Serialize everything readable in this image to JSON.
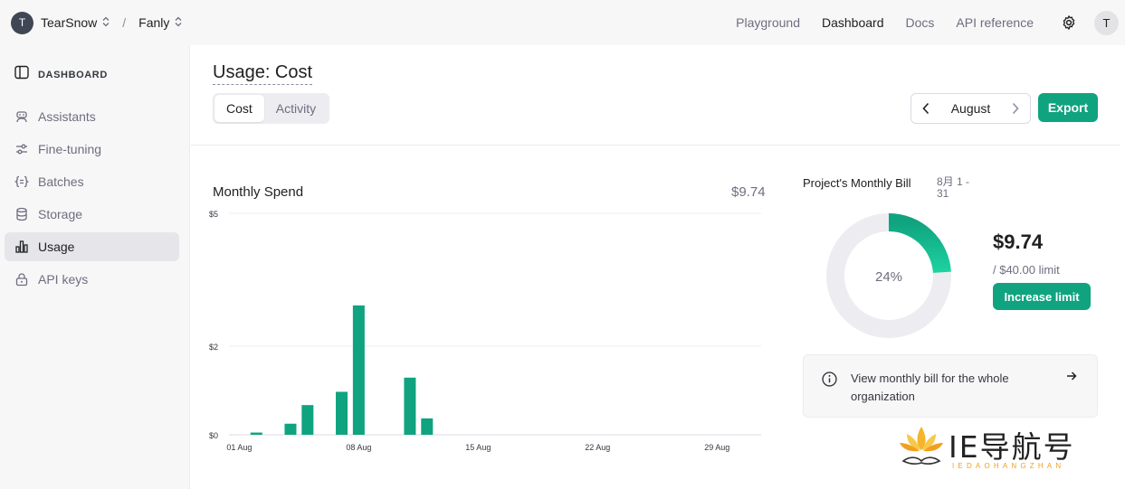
{
  "topbar": {
    "org_initial": "T",
    "org_name": "TearSnow",
    "project_name": "Fanly",
    "nav": [
      "Playground",
      "Dashboard",
      "Docs",
      "API reference"
    ],
    "active_nav": "Dashboard",
    "user_initial": "T",
    "icons": {
      "settings": "gear-icon",
      "switcher": "chevron-updown-icon"
    }
  },
  "sidebar": {
    "heading": "DASHBOARD",
    "items": [
      {
        "label": "Assistants",
        "icon": "robot-icon"
      },
      {
        "label": "Fine-tuning",
        "icon": "sliders-icon"
      },
      {
        "label": "Batches",
        "icon": "braces-icon"
      },
      {
        "label": "Storage",
        "icon": "database-icon"
      },
      {
        "label": "Usage",
        "icon": "bar-chart-icon",
        "active": true
      },
      {
        "label": "API keys",
        "icon": "lock-icon"
      }
    ]
  },
  "main": {
    "title": "Usage: Cost",
    "tabs": [
      {
        "label": "Cost",
        "active": true
      },
      {
        "label": "Activity",
        "active": false
      }
    ],
    "month": "August",
    "export_label": "Export"
  },
  "spend": {
    "title": "Monthly Spend",
    "total": "$9.74"
  },
  "bill": {
    "title": "Project's Monthly Bill",
    "range": "8月 1 - 31",
    "percent_label": "24%",
    "percent": 0.24,
    "amount": "$9.74",
    "limit": "/ $40.00 limit",
    "increase_label": "Increase limit",
    "org_link_text": "View monthly bill for the whole organization"
  },
  "colors": {
    "accent": "#10a37f",
    "track": "#ececf1",
    "donut_light": "#1dc79a"
  },
  "chart_data": {
    "type": "bar",
    "title": "Monthly Spend",
    "xlabel": "",
    "ylabel": "",
    "ylim": [
      0,
      5
    ],
    "y_ticks": [
      "$0",
      "$2",
      "$5"
    ],
    "y_tick_values": [
      0,
      2,
      5
    ],
    "x_tick_labels": [
      "01 Aug",
      "08 Aug",
      "15 Aug",
      "22 Aug",
      "29 Aug"
    ],
    "categories": [
      "Aug 1",
      "Aug 2",
      "Aug 3",
      "Aug 4",
      "Aug 5",
      "Aug 6",
      "Aug 7",
      "Aug 8",
      "Aug 9",
      "Aug 10",
      "Aug 11",
      "Aug 12",
      "Aug 13",
      "Aug 14",
      "Aug 15",
      "Aug 16",
      "Aug 17",
      "Aug 18",
      "Aug 19",
      "Aug 20",
      "Aug 21",
      "Aug 22",
      "Aug 23",
      "Aug 24",
      "Aug 25",
      "Aug 26",
      "Aug 27",
      "Aug 28",
      "Aug 29",
      "Aug 30",
      "Aug 31"
    ],
    "values": [
      0,
      0.05,
      0,
      0.25,
      0.67,
      0,
      0.97,
      2.92,
      0,
      0,
      1.29,
      0.37,
      0,
      0,
      0,
      0,
      0,
      0,
      0,
      0,
      0,
      0,
      0,
      0,
      0,
      0,
      0,
      0,
      0,
      0,
      0
    ],
    "grid": true,
    "legend": "none"
  },
  "watermark": {
    "text": "IE导航号",
    "sub": "IEDAOHANGZHAN"
  }
}
